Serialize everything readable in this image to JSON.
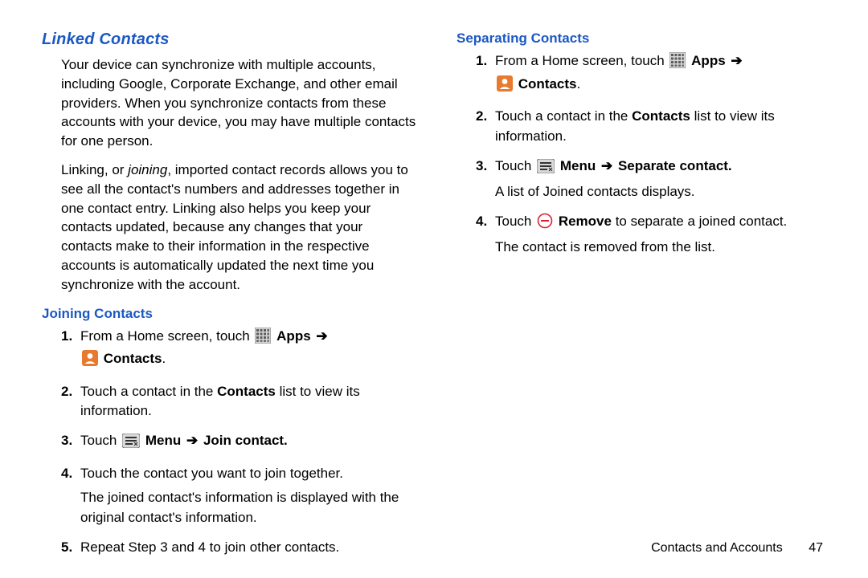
{
  "left": {
    "heading_linked": "Linked Contacts",
    "para1": "Your device can synchronize with multiple accounts, including Google, Corporate Exchange, and other email providers. When you synchronize contacts from these accounts with your device, you may have multiple contacts for one person.",
    "para2_a": "Linking, or ",
    "para2_em": "joining",
    "para2_b": ", imported contact records allows you to see all the contact's numbers and addresses together in one contact entry. Linking also helps you keep your contacts updated, because any changes that your contacts make to their information in the respective accounts is automatically updated the next time you synchronize with the account.",
    "heading_joining": "Joining Contacts",
    "step1_a": "From a Home screen, touch ",
    "step1_apps": "Apps",
    "step1_contacts": "Contacts",
    "step1_period": ".",
    "step2_a": "Touch a contact in the ",
    "step2_bold": "Contacts",
    "step2_b": " list to view its information.",
    "step3_a": "Touch ",
    "step3_menu": "Menu",
    "step3_join": "Join contact.",
    "step4": "Touch the contact you want to join together.",
    "step4_note": "The joined contact's information is displayed with the original contact's information.",
    "step5": "Repeat Step 3 and 4 to join other contacts."
  },
  "right": {
    "heading_separating": "Separating Contacts",
    "step1_a": "From a Home screen, touch ",
    "step1_apps": "Apps",
    "step1_contacts": "Contacts",
    "step1_period": ".",
    "step2_a": "Touch a contact in the ",
    "step2_bold": "Contacts",
    "step2_b": " list to view its information.",
    "step3_a": "Touch ",
    "step3_menu": "Menu",
    "step3_sep": "Separate contact.",
    "step3_note": "A list of Joined contacts displays.",
    "step4_a": "Touch ",
    "step4_remove": "Remove",
    "step4_b": " to separate a joined contact.",
    "step4_note": "The contact is removed from the list."
  },
  "nums": {
    "n1": "1.",
    "n2": "2.",
    "n3": "3.",
    "n4": "4.",
    "n5": "5."
  },
  "arrow": "➔",
  "footer": {
    "section": "Contacts and Accounts",
    "page": "47"
  }
}
